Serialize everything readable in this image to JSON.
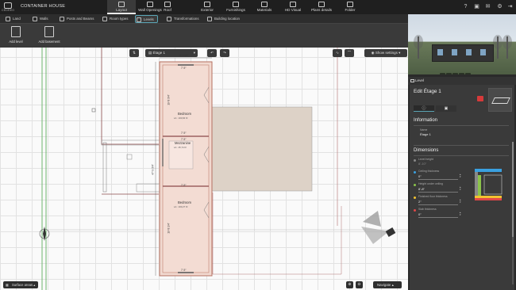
{
  "app": {
    "brand": "CEDREO",
    "project_title": "CONTAINER HOUSE"
  },
  "main_tabs": [
    {
      "label": "Layout"
    },
    {
      "label": "Wall Openings"
    },
    {
      "label": "Roof"
    },
    {
      "label": "Exterior"
    },
    {
      "label": "Furnishings"
    },
    {
      "label": "Materials"
    },
    {
      "label": "HD Visual"
    },
    {
      "label": "Plans details"
    },
    {
      "label": "Folder"
    }
  ],
  "sub_tabs": [
    {
      "label": "Land"
    },
    {
      "label": "Walls"
    },
    {
      "label": "Posts and Beams"
    },
    {
      "label": "Room types"
    },
    {
      "label": "Levels"
    },
    {
      "label": "Transformations"
    },
    {
      "label": "Building location"
    }
  ],
  "toolbar": {
    "add_level": "Add level",
    "add_basement": "Add basement"
  },
  "canvas": {
    "level_select": "Étage 1",
    "show_settings": "Show settings",
    "surface_areas": "Surface areas",
    "navigate": "Navigate"
  },
  "plan": {
    "top_dim": "8'-1 1/2\"",
    "rooms": [
      {
        "name": "Bedroom",
        "area": "LA : 100,84 ft²"
      },
      {
        "name": "Mezzanine",
        "area": "LA : 45,74 ft²"
      },
      {
        "name": "Bedroom",
        "area": "LA : 100,27 ft²"
      }
    ],
    "dims": [
      "7'-9\"",
      "19'-8 3/4\"",
      "7'-9\"",
      "7'-9\"",
      "47'-9 3/4\"",
      "7'-9\"",
      "19'-8 1/4\"",
      "7'-9\""
    ]
  },
  "panel": {
    "header": "Level",
    "edit_title": "Edit Étage 1",
    "information_title": "Information",
    "name_label": "Name",
    "name_value": "Étage 1",
    "dimensions_title": "Dimensions",
    "fields": [
      {
        "label": "Level height",
        "value": "8'-10\"",
        "color": "#888888"
      },
      {
        "label": "Ceiling thickness",
        "value": "0\"",
        "color": "#3aa0e0"
      },
      {
        "label": "Height under ceiling",
        "value": "8'-8\"",
        "color": "#8bc34a"
      },
      {
        "label": "Finished floor thickness",
        "value": "2\"",
        "color": "#f2c230"
      },
      {
        "label": "Slab thickness",
        "value": "0\"",
        "color": "#e04848"
      }
    ]
  }
}
